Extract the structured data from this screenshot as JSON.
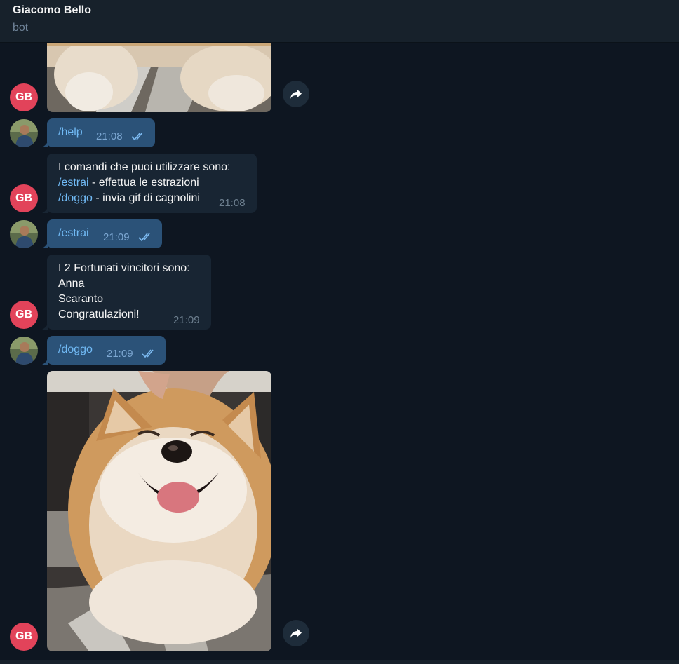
{
  "header": {
    "title": "Giacomo Bello",
    "subtitle": "bot"
  },
  "avatars": {
    "bot_initials": "GB"
  },
  "messages": {
    "help": {
      "text": "/help",
      "time": "21:08"
    },
    "commands": {
      "line1": "I comandi che puoi utilizzare sono:",
      "line2_cmd": "/estrai",
      "line2_rest": " - effettua le estrazioni",
      "line3_cmd": "/doggo",
      "line3_rest": " - invia gif di cagnolini",
      "time": "21:08"
    },
    "estrai": {
      "text": "/estrai",
      "time": "21:09"
    },
    "winners": {
      "line1": "I 2 Fortunati vincitori sono:",
      "line2": "Anna",
      "line3": "Scaranto",
      "line4": "Congratulazioni!",
      "time": "21:09"
    },
    "doggo": {
      "text": "/doggo",
      "time": "21:09"
    }
  },
  "icons": {
    "share": "share-arrow-icon",
    "read": "double-check-icon"
  },
  "colors": {
    "background": "#0e1621",
    "header": "#17212b",
    "incoming_bubble": "#182533",
    "outgoing_bubble": "#2b5278",
    "link": "#71baf5",
    "avatar": "#e2435a"
  }
}
